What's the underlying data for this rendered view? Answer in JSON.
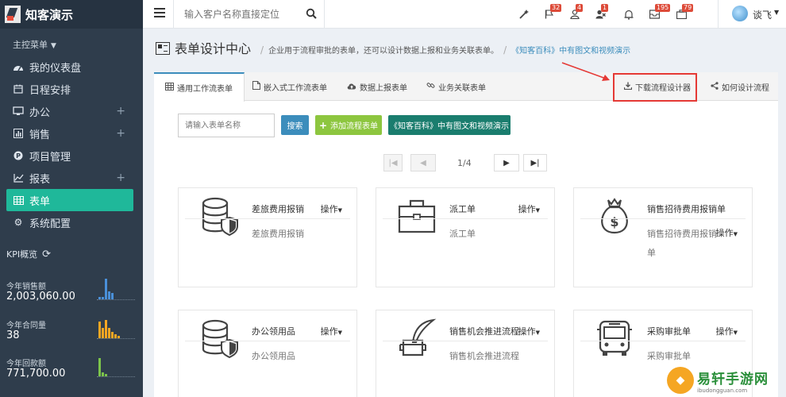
{
  "brand": {
    "title": "知客演示"
  },
  "sidebar": {
    "menu_title": "主控菜单",
    "items": [
      {
        "label": "我的仪表盘",
        "icon": "dashboard-icon"
      },
      {
        "label": "日程安排",
        "icon": "calendar-icon"
      },
      {
        "label": "办公",
        "icon": "desktop-icon",
        "expandable": true
      },
      {
        "label": "销售",
        "icon": "bar-chart-icon",
        "expandable": true
      },
      {
        "label": "项目管理",
        "icon": "project-icon"
      },
      {
        "label": "报表",
        "icon": "line-chart-icon",
        "expandable": true
      },
      {
        "label": "表单",
        "icon": "table-icon",
        "active": true
      },
      {
        "label": "系统配置",
        "icon": "gear-icon"
      }
    ],
    "kpi_title": "KPI概览",
    "kpis": [
      {
        "label": "今年销售额",
        "value": "2,003,060.00",
        "color": "#4a90d9",
        "bars": [
          0.1,
          0.1,
          1.0,
          0.4,
          0.3
        ]
      },
      {
        "label": "今年合同量",
        "value": "38",
        "color": "#f5a623",
        "bars": [
          0.8,
          0.5,
          0.9,
          0.5,
          0.3,
          0.2,
          0.1
        ]
      },
      {
        "label": "今年回款额",
        "value": "771,700.00",
        "color": "#7cc44b",
        "bars": [
          0.9,
          0.2,
          0.1
        ]
      }
    ]
  },
  "topbar": {
    "search_placeholder": "输入客户名称直接定位",
    "icons": [
      {
        "name": "magic-icon",
        "badge": ""
      },
      {
        "name": "flag-icon",
        "badge": "32"
      },
      {
        "name": "user-icon",
        "badge": "4"
      },
      {
        "name": "user-remove-icon",
        "badge": "1"
      },
      {
        "name": "bell-icon",
        "badge": ""
      },
      {
        "name": "inbox-icon",
        "badge": "195"
      },
      {
        "name": "briefcase-icon",
        "badge": "79"
      }
    ],
    "user_name": "谈飞"
  },
  "page": {
    "title": "表单设计中心",
    "description": "企业用于流程审批的表单，还可以设计数据上报和业务关联表单。",
    "link": "《知客百科》中有图文和视频演示"
  },
  "tabs": [
    {
      "label": "通用工作流表单",
      "icon": "table-icon",
      "active": true
    },
    {
      "label": "嵌入式工作流表单",
      "icon": "file-icon"
    },
    {
      "label": "数据上报表单",
      "icon": "cloud-upload-icon"
    },
    {
      "label": "业务关联表单",
      "icon": "link-icon"
    },
    {
      "label": "下载流程设计器",
      "icon": "download-icon",
      "highlighted": true
    },
    {
      "label": "如何设计流程",
      "icon": "share-icon"
    }
  ],
  "toolbar": {
    "filter_placeholder": "请输入表单名称",
    "search_label": "搜索",
    "add_label": "添加流程表单",
    "guide_label": "《知客百科》中有图文和视频演示"
  },
  "pagination": {
    "text": "1/4"
  },
  "cards": [
    {
      "title": "差旅费用报销",
      "sub": "差旅费用报销",
      "op": "操作",
      "icon": "database-shield-icon"
    },
    {
      "title": "派工单",
      "sub": "派工单",
      "op": "操作",
      "icon": "briefcase-icon"
    },
    {
      "title": "销售招待费用报销单",
      "sub": "销售招待费用报销单",
      "op": "操作",
      "icon": "money-bag-icon"
    },
    {
      "title": "办公领用品",
      "sub": "办公领用品",
      "op": "操作",
      "icon": "database-shield-icon"
    },
    {
      "title": "销售机会推进流程",
      "sub": "销售机会推进流程",
      "op": "操作",
      "icon": "inkwell-icon"
    },
    {
      "title": "采购审批单",
      "sub": "采购审批单",
      "op": "操作",
      "icon": "bus-icon"
    }
  ],
  "watermark": {
    "main": "易轩手游网",
    "sub": "ibudongguan.com"
  }
}
